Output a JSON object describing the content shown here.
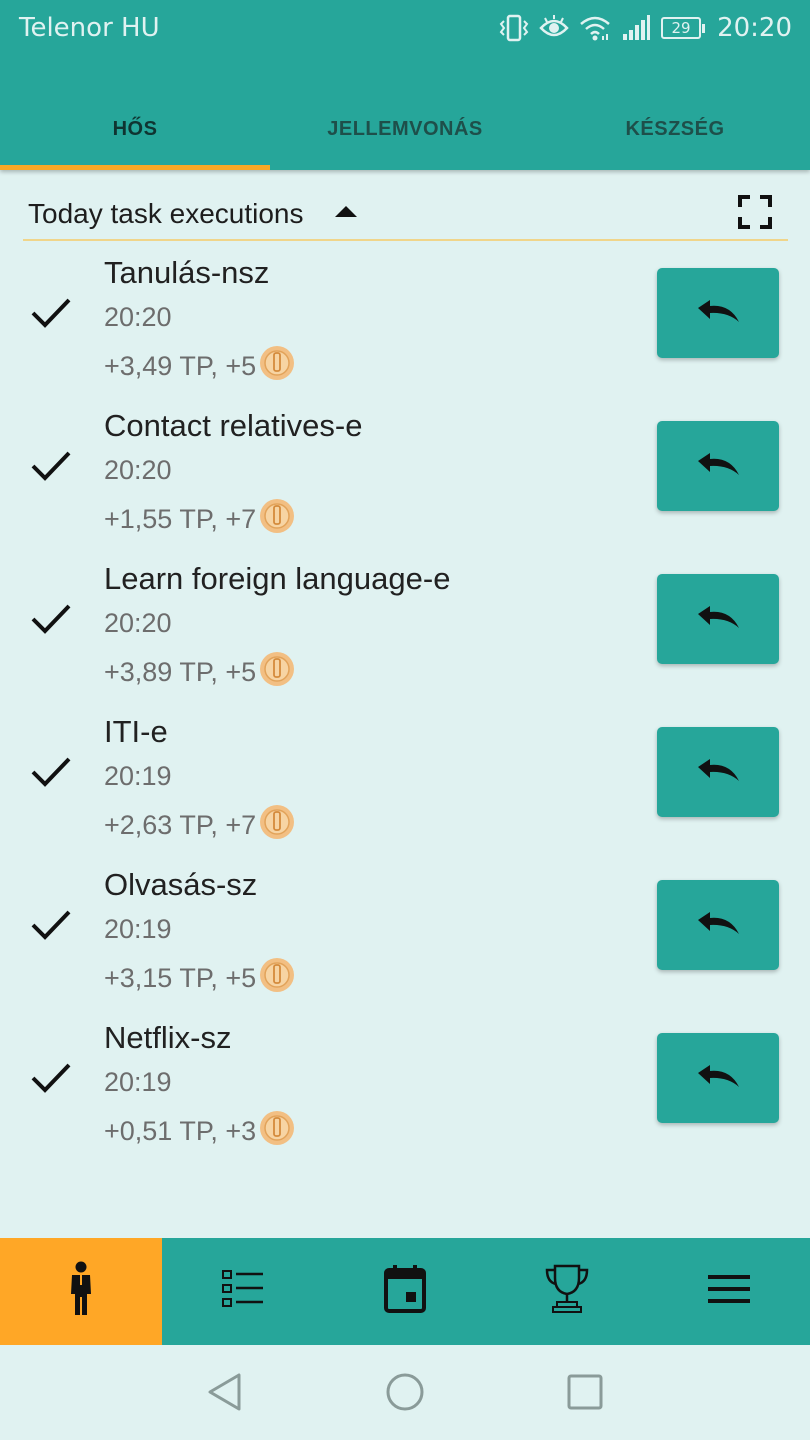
{
  "status_bar": {
    "carrier": "Telenor HU",
    "battery": "29",
    "time": "20:20",
    "icons": [
      "vibrate-icon",
      "eye-icon",
      "wifi-icon",
      "signal-icon",
      "battery-icon"
    ]
  },
  "tabs": [
    {
      "label": "HŐS",
      "active": true
    },
    {
      "label": "JELLEMVONÁS",
      "active": false
    },
    {
      "label": "KÉSZSÉG",
      "active": false
    }
  ],
  "section": {
    "title": "Today task executions"
  },
  "tasks": [
    {
      "name": "Tanulás-nsz",
      "time": "20:20",
      "reward": "+3,49 TP, +5"
    },
    {
      "name": "Contact relatives-e",
      "time": "20:20",
      "reward": "+1,55 TP, +7"
    },
    {
      "name": "Learn foreign language-e",
      "time": "20:20",
      "reward": "+3,89 TP, +5"
    },
    {
      "name": "ITI-e",
      "time": "20:19",
      "reward": "+2,63 TP, +7"
    },
    {
      "name": "Olvasás-sz",
      "time": "20:19",
      "reward": "+3,15 TP, +5"
    },
    {
      "name": "Netflix-sz",
      "time": "20:19",
      "reward": "+0,51 TP, +3"
    }
  ],
  "bottom_nav": [
    {
      "icon": "hero-person-icon",
      "active": true
    },
    {
      "icon": "task-list-icon",
      "active": false
    },
    {
      "icon": "calendar-icon",
      "active": false
    },
    {
      "icon": "trophy-icon",
      "active": false
    },
    {
      "icon": "menu-icon",
      "active": false
    }
  ],
  "colors": {
    "primary": "#26a69a",
    "accent": "#ffa726",
    "tab_indicator": "#f9a825",
    "background": "#e0f2f1"
  }
}
